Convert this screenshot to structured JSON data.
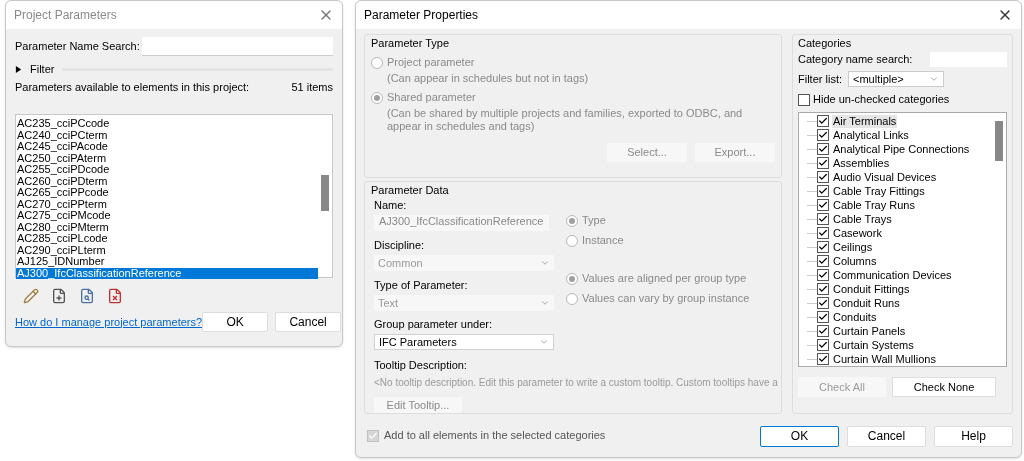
{
  "project_parameters": {
    "title": "Project Parameters",
    "search_label": "Parameter Name Search:",
    "filter": {
      "label": "Filter",
      "expanded": false
    },
    "list_caption": "Parameters available to elements in this project:",
    "count": "51 items",
    "items": [
      {
        "label": "AC235_cciPCcode",
        "selected": false
      },
      {
        "label": "AC240_cciPCterm",
        "selected": false
      },
      {
        "label": "AC245_cciPAcode",
        "selected": false
      },
      {
        "label": "AC250_cciPAterm",
        "selected": false
      },
      {
        "label": "AC255_cciPDcode",
        "selected": false
      },
      {
        "label": "AC260_cciPDterm",
        "selected": false
      },
      {
        "label": "AC265_cciPPcode",
        "selected": false
      },
      {
        "label": "AC270_cciPPterm",
        "selected": false
      },
      {
        "label": "AC275_cciPMcode",
        "selected": false
      },
      {
        "label": "AC280_cciPMterm",
        "selected": false
      },
      {
        "label": "AC285_cciPLcode",
        "selected": false
      },
      {
        "label": "AC290_cciPLterm",
        "selected": false
      },
      {
        "label": "AJ125_IDNumber",
        "selected": false
      },
      {
        "label": "AJ300_IfcClassificationReference",
        "selected": true
      }
    ],
    "help_link": "How do I manage project parameters?",
    "buttons": [
      "OK",
      "Cancel"
    ]
  },
  "parameter_properties": {
    "title": "Parameter Properties",
    "parameter_type": {
      "title": "Parameter Type",
      "options": [
        {
          "label": "Project parameter",
          "description": "(Can appear in schedules but not in tags)",
          "selected": false
        },
        {
          "label": "Shared parameter",
          "description": "(Can be shared by multiple projects and families, exported to ODBC, and appear in schedules and tags)",
          "selected": true
        }
      ],
      "buttons": [
        "Select...",
        "Export..."
      ]
    },
    "parameter_data": {
      "title": "Parameter Data",
      "name_label": "Name:",
      "name_value": "AJ300_IfcClassificationReference",
      "discipline_label": "Discipline:",
      "discipline_value": "Common",
      "type_label": "Type of Parameter:",
      "type_value": "Text",
      "group_label": "Group parameter under:",
      "group_value": "IFC Parameters",
      "scope_options": [
        {
          "label": "Type",
          "selected": true
        },
        {
          "label": "Instance",
          "selected": false
        }
      ],
      "group_options": [
        {
          "label": "Values are aligned per group type",
          "selected": true
        },
        {
          "label": "Values can vary by group instance",
          "selected": false
        }
      ],
      "tooltip_label": "Tooltip Description:",
      "tooltip_text": "<No tooltip description. Edit this parameter to write a custom tooltip. Custom tooltips have a",
      "edit_button": "Edit Tooltip..."
    },
    "add_to_all": {
      "label": "Add to all elements in the selected categories",
      "checked": true
    },
    "categories": {
      "title": "Categories",
      "search_label": "Category name search:",
      "filter_label": "Filter list:",
      "filter_value": "<multiple>",
      "hide_label": "Hide un-checked categories",
      "hide_checked": false,
      "items": [
        {
          "label": "Air Terminals",
          "checked": true,
          "selected": true
        },
        {
          "label": "Analytical Links",
          "checked": true,
          "selected": false
        },
        {
          "label": "Analytical Pipe Connections",
          "checked": true,
          "selected": false
        },
        {
          "label": "Assemblies",
          "checked": true,
          "selected": false
        },
        {
          "label": "Audio Visual Devices",
          "checked": true,
          "selected": false
        },
        {
          "label": "Cable Tray Fittings",
          "checked": true,
          "selected": false
        },
        {
          "label": "Cable Tray Runs",
          "checked": true,
          "selected": false
        },
        {
          "label": "Cable Trays",
          "checked": true,
          "selected": false
        },
        {
          "label": "Casework",
          "checked": true,
          "selected": false
        },
        {
          "label": "Ceilings",
          "checked": true,
          "selected": false
        },
        {
          "label": "Columns",
          "checked": true,
          "selected": false
        },
        {
          "label": "Communication Devices",
          "checked": true,
          "selected": false
        },
        {
          "label": "Conduit Fittings",
          "checked": true,
          "selected": false
        },
        {
          "label": "Conduit Runs",
          "checked": true,
          "selected": false
        },
        {
          "label": "Conduits",
          "checked": true,
          "selected": false
        },
        {
          "label": "Curtain Panels",
          "checked": true,
          "selected": false
        },
        {
          "label": "Curtain Systems",
          "checked": true,
          "selected": false
        },
        {
          "label": "Curtain Wall Mullions",
          "checked": true,
          "selected": false
        }
      ],
      "check_all": "Check All",
      "check_none": "Check None"
    },
    "buttons": [
      "OK",
      "Cancel",
      "Help"
    ]
  }
}
